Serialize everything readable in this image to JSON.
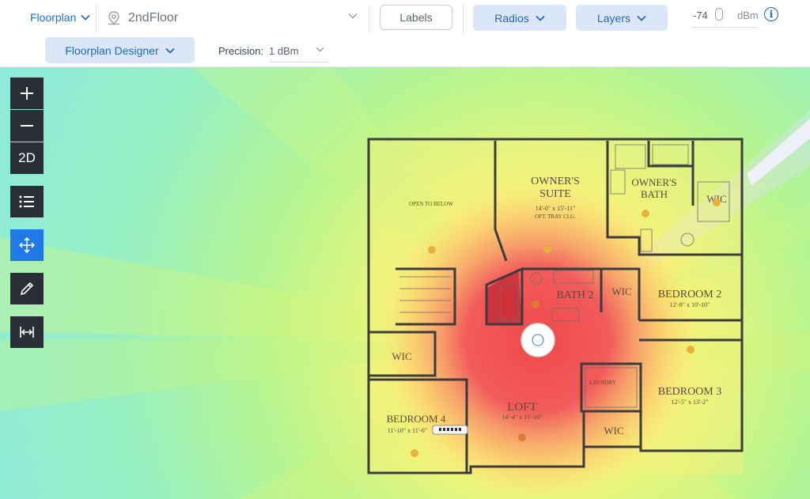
{
  "header": {
    "view_dropdown": "Floorplan",
    "floor_name": "2ndFloor",
    "labels_button": "Labels",
    "radios_button": "Radios",
    "layers_button": "Layers",
    "threshold_value": "-74",
    "threshold_unit": "dBm",
    "info_glyph": "i"
  },
  "subheader": {
    "designer_button": "Floorplan Designer",
    "precision_label": "Precision:",
    "precision_value": "1 dBm"
  },
  "toolbar": {
    "zoom_in": "+",
    "zoom_out": "−",
    "view_mode": "2D",
    "tools": [
      "zoom-in",
      "zoom-out",
      "2d-toggle",
      "list-icon",
      "move-icon",
      "pencil-icon",
      "measure-icon"
    ]
  },
  "floorplan": {
    "rooms": {
      "owners_suite": "OWNER'S\nSUITE",
      "owners_suite_dim": "14'-0\" x 15'-11\"",
      "owners_suite_note": "OPT. TRAY CLG.",
      "owners_bath": "OWNER'S\nBATH",
      "wic_top": "WIC",
      "open_to_below": "OPEN TO BELOW",
      "bath2": "BATH 2",
      "wic_mid": "WIC",
      "bedroom2": "BEDROOM 2",
      "bedroom2_dim": "12'-8\" x 10'-10\"",
      "wic_left": "WIC",
      "loft": "LOFT",
      "loft_dim": "14'-4\" x 11'-10\"",
      "laundry": "LAUNDRY",
      "bedroom3": "BEDROOM 3",
      "bedroom3_dim": "12'-5\" x 13'-2\"",
      "bedroom4": "BEDROOM 4",
      "bedroom4_dim": "11'-10\" x 11'-6\"",
      "wic_bottom": "WIC"
    }
  },
  "colors": {
    "accent": "#1f7ae8",
    "accent_light": "#dbe7f7",
    "toolbar_dark": "#2a2f37",
    "heat_strong": "#f25b5b",
    "heat_medium": "#f5e46a",
    "heat_weak": "#97f0c2"
  }
}
